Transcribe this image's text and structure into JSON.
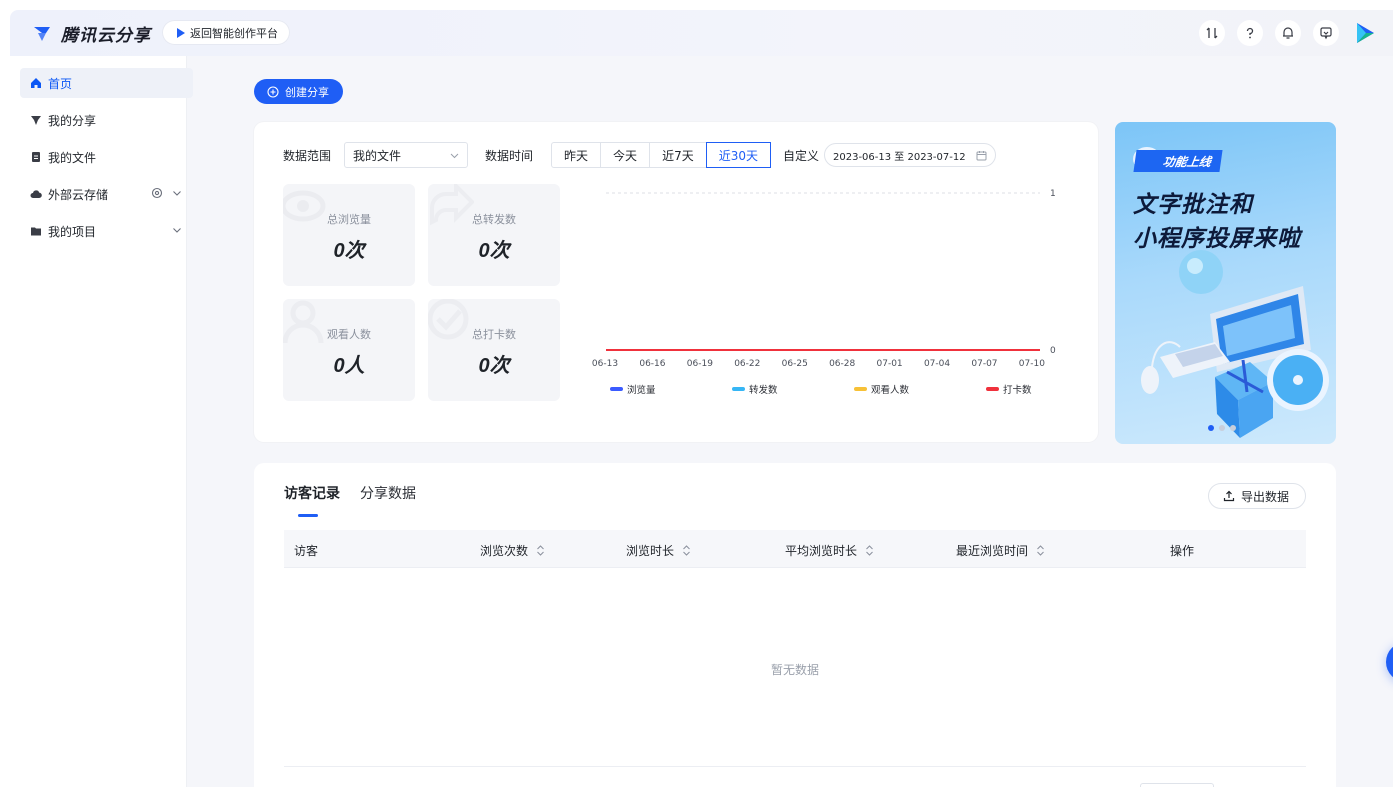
{
  "header": {
    "brand": "腾讯云分享",
    "back_label": "返回智能创作平台",
    "icons": [
      "transfer-icon",
      "help-icon",
      "bell-icon",
      "message-icon",
      "app-logo-icon"
    ]
  },
  "sidebar": {
    "items": [
      {
        "label": "首页",
        "icon": "home-icon",
        "active": true
      },
      {
        "label": "我的分享",
        "icon": "share-icon"
      },
      {
        "label": "我的文件",
        "icon": "file-icon"
      },
      {
        "label": "外部云存储",
        "icon": "cloud-icon"
      },
      {
        "label": "我的项目",
        "icon": "folder-icon"
      }
    ]
  },
  "main": {
    "create_label": "创建分享",
    "filters": {
      "scope_label": "数据范围",
      "scope_value": "我的文件",
      "time_label": "数据时间",
      "options": [
        "昨天",
        "今天",
        "近7天",
        "近30天"
      ],
      "selected": "近30天",
      "custom_label": "自定义",
      "date_range": "2023-06-13 至 2023-07-12"
    },
    "stats": [
      {
        "label": "总浏览量",
        "value": "0次"
      },
      {
        "label": "总转发数",
        "value": "0次"
      },
      {
        "label": "观看人数",
        "value": "0人"
      },
      {
        "label": "总打卡数",
        "value": "0次"
      }
    ]
  },
  "chart_data": {
    "type": "line",
    "x": [
      "06-13",
      "06-16",
      "06-19",
      "06-22",
      "06-25",
      "06-28",
      "07-01",
      "07-04",
      "07-07",
      "07-10"
    ],
    "ylim": [
      0,
      1
    ],
    "y_ticks": [
      "0",
      "1"
    ],
    "series": [
      {
        "name": "浏览量",
        "color": "#3b5bff",
        "values": [
          0,
          0,
          0,
          0,
          0,
          0,
          0,
          0,
          0,
          0
        ]
      },
      {
        "name": "转发数",
        "color": "#36b6f5",
        "values": [
          0,
          0,
          0,
          0,
          0,
          0,
          0,
          0,
          0,
          0
        ]
      },
      {
        "name": "观看人数",
        "color": "#f7c137",
        "values": [
          0,
          0,
          0,
          0,
          0,
          0,
          0,
          0,
          0,
          0
        ]
      },
      {
        "name": "打卡数",
        "color": "#f0313c",
        "values": [
          0,
          0,
          0,
          0,
          0,
          0,
          0,
          0,
          0,
          0
        ]
      }
    ],
    "legend": "bottom"
  },
  "banner": {
    "tag": "功能上线",
    "line1": "文字批注和",
    "line2": "小程序投屏来啦",
    "dots": 3,
    "active_dot": 0
  },
  "records": {
    "tabs": [
      "访客记录",
      "分享数据"
    ],
    "active_tab": "访客记录",
    "export_label": "导出数据",
    "columns": [
      "访客",
      "浏览次数",
      "浏览时长",
      "平均浏览时长",
      "最近浏览时间",
      "操作"
    ],
    "empty_text": "暂无数据"
  },
  "colors": {
    "accent": "#1f5ef5",
    "page_bg": "#f5f6fa"
  }
}
